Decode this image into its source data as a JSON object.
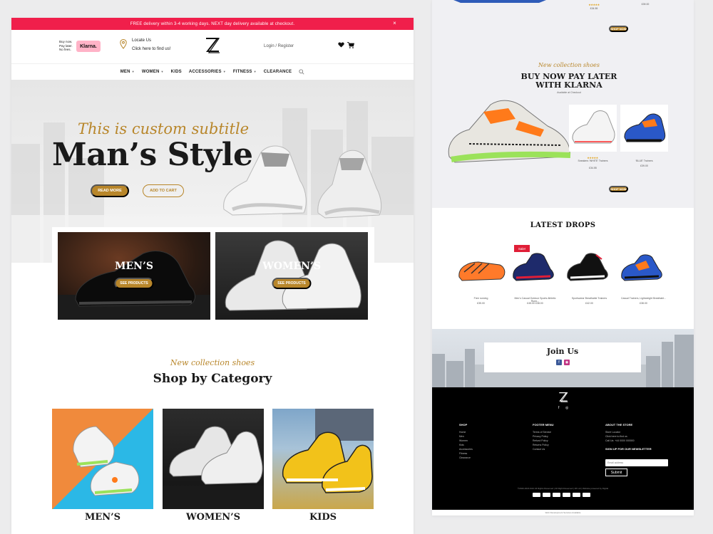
{
  "announcement": {
    "text": "FREE delivery within 3-4 working days. NEXT day delivery available at checkout.",
    "close": "×"
  },
  "header": {
    "bnpl_text": "Buy now. Pay later. No fees.",
    "klarna": "Klarna.",
    "locate_title": "Locate Us",
    "locate_sub": "Click here to find us!",
    "login": "Login / Register"
  },
  "nav": [
    {
      "label": "MEN",
      "caret": true
    },
    {
      "label": "WOMEN",
      "caret": true
    },
    {
      "label": "KIDS",
      "caret": false
    },
    {
      "label": "ACCESSORIES",
      "caret": true
    },
    {
      "label": "FITNESS",
      "caret": true
    },
    {
      "label": "CLEARANCE",
      "caret": false
    }
  ],
  "hero": {
    "subtitle": "This is custom subtitle",
    "title": "Man’s Style",
    "read_more": "READ MORE",
    "add_to_cart": "ADD TO CART"
  },
  "categories_top": [
    {
      "label": "MEN’S",
      "button": "SEE PRODUCTS"
    },
    {
      "label": "WOMEN’S",
      "button": "SEE PRODUCTS"
    }
  ],
  "shop_section": {
    "subtitle": "New collection shoes",
    "title": "Shop by Category",
    "cards": [
      {
        "label": "MEN’S"
      },
      {
        "label": "WOMEN’S"
      },
      {
        "label": "KIDS"
      }
    ]
  },
  "right_top": {
    "prices": [
      "£34.55",
      "£39.00"
    ],
    "shop_now": "SHOP NOW"
  },
  "klarna_section": {
    "subtitle": "New collection shoes",
    "title_line1": "BUY NOW PAY LATER",
    "title_line2": "WITH KLARNA",
    "small": "Available at Checkout",
    "products": [
      {
        "name": "Sneakers ‘WHITE’ Trainers",
        "price": "£34.55"
      },
      {
        "name": "‘BLUE’ Trainers",
        "price": "£39.00"
      }
    ],
    "shop_now": "SHOP NOW"
  },
  "latest": {
    "title": "LATEST DROPS",
    "sale": "Sale!",
    "products": [
      {
        "name": "Free running",
        "price": "£35.00"
      },
      {
        "name": "Men’s Casual Outdoor Sports Athletic Runn...",
        "price": "£45.00 £38.00"
      },
      {
        "name": "Sportswear Breathable Trainers",
        "price": "£42.00"
      },
      {
        "name": "Casual Trainers, Lightweight Breathabl...",
        "price": "£38.00"
      }
    ]
  },
  "join": {
    "title": "Join Us",
    "facebook": "f",
    "instagram": "◉"
  },
  "footer": {
    "shop_heading": "SHOP",
    "shop_links": [
      "Home",
      "Men",
      "Women",
      "Kids",
      "Accessories",
      "Fitness",
      "Clearance"
    ],
    "menu_heading": "FOOTER MENU",
    "menu_links": [
      "Terms of Service",
      "Privacy Policy",
      "Refund Policy",
      "Returns Policy",
      "Contact Us"
    ],
    "about_heading": "ABOUT THE STORE",
    "about_lines": [
      "Store Locator",
      "Click here to find us",
      "Call Us: +44 0000 000000"
    ],
    "newsletter_heading": "SIGN UP FOR OUR NEWSLETTER",
    "newsletter_placeholder": "Email address",
    "submit": "Submit",
    "copyright": "©2020-2023 ZAK All Rights Reserved | All Right Reserved | ZZ Ltd | Website powered by Digital"
  },
  "below_footer": "Web Development Services Available"
}
